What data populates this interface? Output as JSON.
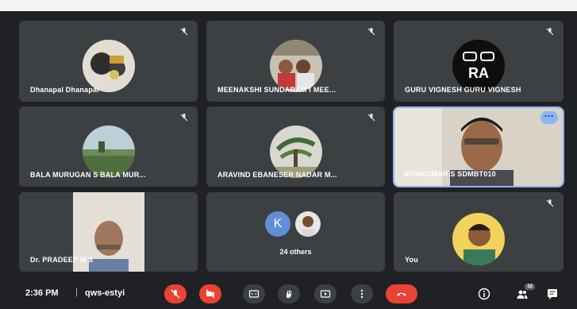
{
  "participants": [
    {
      "name": "Dhanapal Dhanapal",
      "muted": true
    },
    {
      "name": "MEENAKSHI SUNDARAM I MEE...",
      "muted": true
    },
    {
      "name": "GURU VIGNESH GURU VIGNESH",
      "muted": true,
      "logo_text": "RA"
    },
    {
      "name": "BALA MURUGAN S BALA MUR...",
      "muted": true
    },
    {
      "name": "ARAVIND EBANESER NADAR M...",
      "muted": true
    },
    {
      "name": "SIVAKUMAR S SDMBT010",
      "active": true
    },
    {
      "name": "Dr. PRADEEP M S",
      "muted": false
    },
    {
      "name": "You",
      "muted": true
    }
  ],
  "others": {
    "label": "24 others",
    "avatar_letter": "K"
  },
  "toolbar": {
    "time": "2:36 PM",
    "separator": "|",
    "meeting_code": "qws-estyi",
    "participant_count": "32"
  },
  "colors": {
    "background": "#202124",
    "tile": "#3c4043",
    "hangup": "#ea4335",
    "accent": "#8ab4f8"
  }
}
